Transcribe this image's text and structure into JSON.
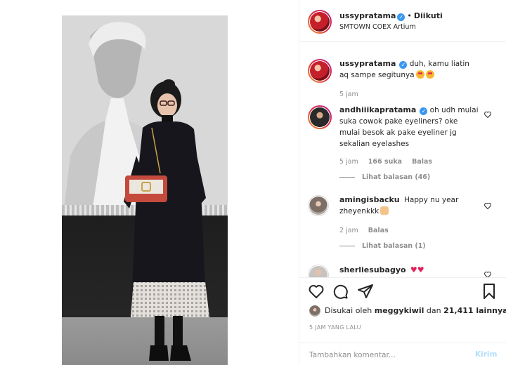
{
  "post": {
    "username": "ussypratama",
    "follow_status": "Diikuti",
    "location": "SMTOWN COEX Artium"
  },
  "comments": [
    {
      "username": "ussypratama",
      "text": "duh, kamu liatin aq sampe segitunya",
      "emoji": [
        "smiling-face-with-heart-eyes",
        "smiling-face-with-heart-eyes"
      ],
      "time": "5 jam",
      "verified": true
    },
    {
      "username": "andhiiikapratama",
      "text": "oh udh mulai suka cowok pake eyeliners? oke mulai besok ak pake eyeliner jg sekalian eyelashes",
      "time": "5 jam",
      "likes": "166 suka",
      "reply_label": "Balas",
      "view_replies": "Lihat balasan (46)",
      "verified": true
    },
    {
      "username": "amingisbacku",
      "text": "Happy nu year zheyenkkk",
      "emoji": [
        "raising-hands"
      ],
      "time": "2 jam",
      "reply_label": "Balas",
      "view_replies": "Lihat balasan (1)"
    },
    {
      "username": "sherliesubagyo",
      "emoji": [
        "red-heart",
        "red-heart"
      ]
    }
  ],
  "likes": {
    "prefix": "Disukai oleh",
    "user": "meggykiwil",
    "middle": "dan",
    "count": "21,411 lainnya"
  },
  "timestamp": "5 JAM YANG LALU",
  "composer": {
    "placeholder": "Tambahkan komentar...",
    "post_label": "Kirim"
  },
  "icons": {
    "verified": "verified-badge-icon",
    "like": "heart-icon",
    "comment": "comment-bubble-icon",
    "share": "paper-plane-icon",
    "save": "bookmark-icon"
  },
  "colors": {
    "verified": "#3897f0",
    "link_disabled": "#b2dffc",
    "secondary_text": "#8e8e8e"
  }
}
